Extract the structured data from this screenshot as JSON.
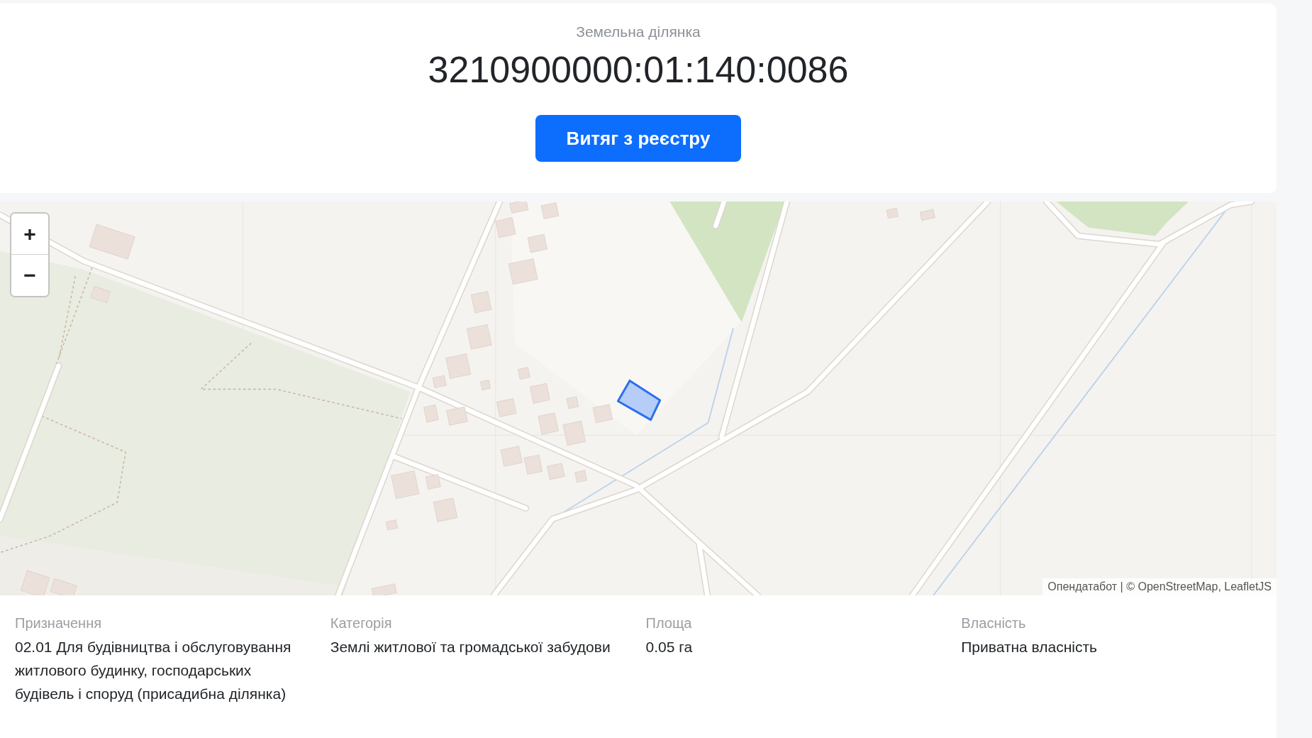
{
  "header": {
    "subtitle": "Земельна ділянка",
    "cadastral_number": "3210900000:01:140:0086",
    "button": "Витяг з реєстру"
  },
  "map": {
    "zoom_buttons": [
      {
        "kind": "zoom-in",
        "label": "+"
      },
      {
        "kind": "zoom-out",
        "label": "−"
      }
    ],
    "attribution": "Опендатабот | © OpenStreetMap, LeafletJS"
  },
  "details": [
    {
      "label": "Призначення",
      "value": "02.01 Для будівництва і обслуговування житлового будинку, господарських будівель і споруд (присадибна ділянка)"
    },
    {
      "label": "Категорія",
      "value": "Землі житлової та громадської забудови"
    },
    {
      "label": "Площа",
      "value": "0.05 га"
    },
    {
      "label": "Власність",
      "value": "Приватна власність"
    }
  ]
}
